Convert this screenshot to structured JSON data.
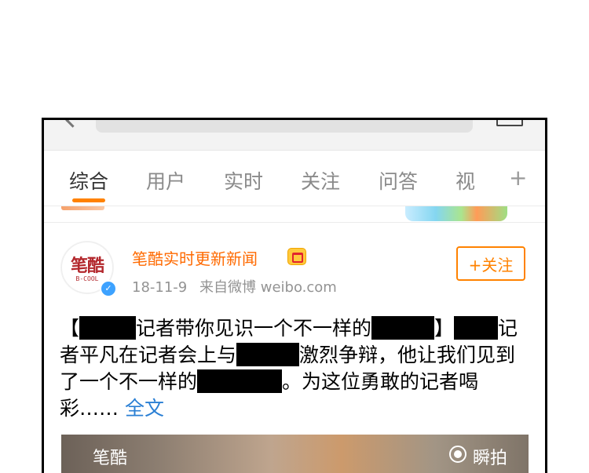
{
  "tabs": {
    "items": [
      {
        "label": "综合"
      },
      {
        "label": "用户"
      },
      {
        "label": "实时"
      },
      {
        "label": "关注"
      },
      {
        "label": "问答"
      },
      {
        "label": "视"
      }
    ],
    "add_label": "+"
  },
  "post": {
    "avatar": {
      "name": "笔酷",
      "sub": "B-COOL"
    },
    "username": "笔酷实时更新新闻",
    "date": "18-11-9",
    "source": "来自微博 weibo.com",
    "follow_label": "+关注",
    "content": {
      "p1": "【",
      "p2": "记者带你见识一个不一样的",
      "p3": "】",
      "p4": "记者平凡在记者会上与",
      "p5": "激烈争辩，他让我们见到了一个不一样的",
      "p6": "。为这位勇敢的记者喝彩……",
      "more_label": "全文"
    },
    "media": {
      "caption": "笔酷",
      "label": "瞬拍"
    }
  },
  "colors": {
    "accent": "#ff8200",
    "username": "#ff6a00",
    "link": "#2a7fd4",
    "verified": "#3da2ff"
  }
}
